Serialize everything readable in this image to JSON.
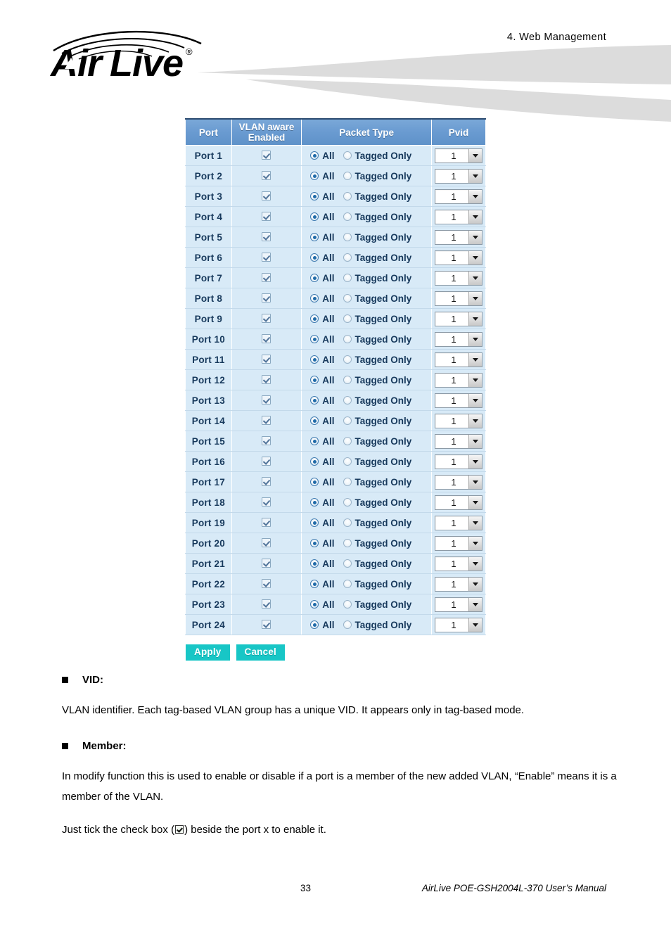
{
  "header": {
    "chapter_title": "4.  Web  Management",
    "logo_text": "Air Live",
    "logo_registered": "®"
  },
  "table": {
    "columns": [
      "Port",
      "VLAN aware Enabled",
      "Packet Type",
      "Pvid"
    ],
    "column_labels": {
      "port": "Port",
      "vlan_aware_line1": "VLAN aware",
      "vlan_aware_line2": "Enabled",
      "packet_type": "Packet Type",
      "pvid": "Pvid"
    },
    "packet_options": [
      "All",
      "Tagged Only"
    ],
    "selected_packet_option": "All",
    "checkbox_checked": true,
    "pvid_value": "1",
    "pvid_options": [
      "1"
    ],
    "rows": [
      {
        "port": "Port 1",
        "vlan_aware": true,
        "packet_type": "All",
        "pvid": "1"
      },
      {
        "port": "Port 2",
        "vlan_aware": true,
        "packet_type": "All",
        "pvid": "1"
      },
      {
        "port": "Port 3",
        "vlan_aware": true,
        "packet_type": "All",
        "pvid": "1"
      },
      {
        "port": "Port 4",
        "vlan_aware": true,
        "packet_type": "All",
        "pvid": "1"
      },
      {
        "port": "Port 5",
        "vlan_aware": true,
        "packet_type": "All",
        "pvid": "1"
      },
      {
        "port": "Port 6",
        "vlan_aware": true,
        "packet_type": "All",
        "pvid": "1"
      },
      {
        "port": "Port 7",
        "vlan_aware": true,
        "packet_type": "All",
        "pvid": "1"
      },
      {
        "port": "Port 8",
        "vlan_aware": true,
        "packet_type": "All",
        "pvid": "1"
      },
      {
        "port": "Port 9",
        "vlan_aware": true,
        "packet_type": "All",
        "pvid": "1"
      },
      {
        "port": "Port 10",
        "vlan_aware": true,
        "packet_type": "All",
        "pvid": "1"
      },
      {
        "port": "Port 11",
        "vlan_aware": true,
        "packet_type": "All",
        "pvid": "1"
      },
      {
        "port": "Port 12",
        "vlan_aware": true,
        "packet_type": "All",
        "pvid": "1"
      },
      {
        "port": "Port 13",
        "vlan_aware": true,
        "packet_type": "All",
        "pvid": "1"
      },
      {
        "port": "Port 14",
        "vlan_aware": true,
        "packet_type": "All",
        "pvid": "1"
      },
      {
        "port": "Port 15",
        "vlan_aware": true,
        "packet_type": "All",
        "pvid": "1"
      },
      {
        "port": "Port 16",
        "vlan_aware": true,
        "packet_type": "All",
        "pvid": "1"
      },
      {
        "port": "Port 17",
        "vlan_aware": true,
        "packet_type": "All",
        "pvid": "1"
      },
      {
        "port": "Port 18",
        "vlan_aware": true,
        "packet_type": "All",
        "pvid": "1"
      },
      {
        "port": "Port 19",
        "vlan_aware": true,
        "packet_type": "All",
        "pvid": "1"
      },
      {
        "port": "Port 20",
        "vlan_aware": true,
        "packet_type": "All",
        "pvid": "1"
      },
      {
        "port": "Port 21",
        "vlan_aware": true,
        "packet_type": "All",
        "pvid": "1"
      },
      {
        "port": "Port 22",
        "vlan_aware": true,
        "packet_type": "All",
        "pvid": "1"
      },
      {
        "port": "Port 23",
        "vlan_aware": true,
        "packet_type": "All",
        "pvid": "1"
      },
      {
        "port": "Port 24",
        "vlan_aware": true,
        "packet_type": "All",
        "pvid": "1"
      }
    ]
  },
  "buttons": {
    "apply": "Apply",
    "cancel": "Cancel"
  },
  "content": {
    "vid_heading": "VID:",
    "vid_text": "VLAN identifier. Each tag-based VLAN group has a unique VID. It appears only in tag-based mode.",
    "member_heading": "Member:",
    "member_text": "In modify function this is used to enable or disable if a port is a member of the new added VLAN, “Enable” means it is a member of the VLAN.",
    "tick_text_before": "Just tick the check box (",
    "tick_text_after": ") beside the port x to enable it."
  },
  "footer": {
    "page_number": "33",
    "manual_name": "AirLive POE-GSH2004L-370 User’s Manual"
  },
  "colors": {
    "header_blue": "#6a9bd1",
    "row_blue": "#d8eaf7",
    "button_teal": "#18c6c6",
    "text_dark_blue": "#17395c",
    "swoosh_gray": "#dcdcdc"
  }
}
